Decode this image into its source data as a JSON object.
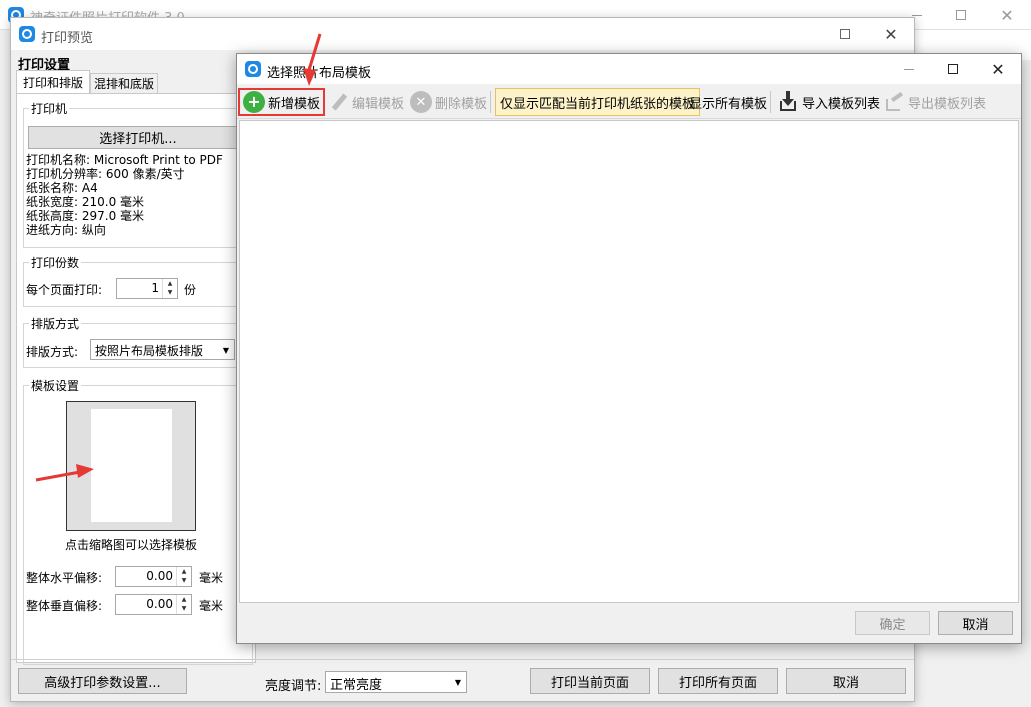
{
  "main_window": {
    "title": "神奇证件照片打印软件 3.0"
  },
  "preview_window": {
    "title": "打印预览",
    "settings_title": "打印设置",
    "tabs": [
      {
        "label": "打印和排版",
        "active": true
      },
      {
        "label": "混排和底版",
        "active": false
      }
    ],
    "printer_group": {
      "legend": "打印机",
      "select_button": "选择打印机...",
      "info": [
        "打印机名称: Microsoft Print to PDF",
        "打印机分辨率: 600 像素/英寸",
        "纸张名称: A4",
        "纸张宽度: 210.0 毫米",
        "纸张高度: 297.0 毫米",
        "进纸方向: 纵向"
      ]
    },
    "copies_group": {
      "legend": "打印份数",
      "label": "每个页面打印:",
      "value": "1",
      "unit": "份"
    },
    "layout_group": {
      "legend": "排版方式",
      "label": "排版方式:",
      "value": "按照片布局模板排版"
    },
    "template_group": {
      "legend": "模板设置",
      "hint": "点击缩略图可以选择模板",
      "h_offset_label": "整体水平偏移:",
      "h_offset_value": "0.00",
      "v_offset_label": "整体垂直偏移:",
      "v_offset_value": "0.00",
      "unit": "毫米"
    },
    "bottom_bar": {
      "advanced_button": "高级打印参数设置...",
      "brightness_label": "亮度调节:",
      "brightness_value": "正常亮度",
      "print_current_button": "打印当前页面",
      "print_all_button": "打印所有页面",
      "cancel_button": "取消"
    }
  },
  "dialog": {
    "title": "选择照片布局模板",
    "toolbar": {
      "add": "新增模板",
      "edit": "编辑模板",
      "delete": "删除模板",
      "filter_matching": "仅显示匹配当前打印机纸张的模板",
      "show_all": "显示所有模板",
      "import": "导入模板列表",
      "export": "导出模板列表"
    },
    "ok_button": "确定",
    "cancel_button": "取消"
  },
  "colors": {
    "highlight_box": "#e53935",
    "add_icon": "#3cb043",
    "filter_toggle_bg": "#fdf2c8",
    "filter_toggle_border": "#e5c365",
    "arrow": "#e53935"
  }
}
